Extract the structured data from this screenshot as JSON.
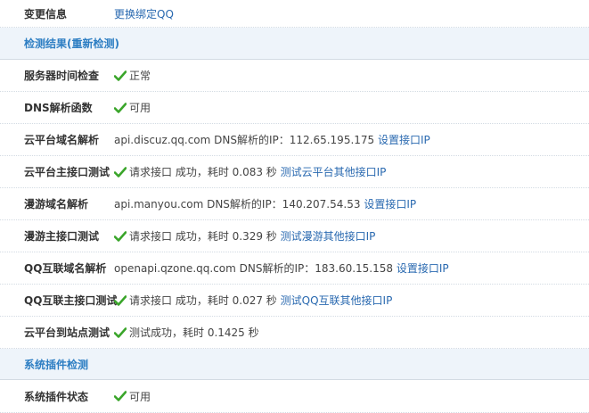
{
  "rows": {
    "change_info": {
      "label": "变更信息",
      "link": "更换绑定QQ"
    },
    "section_check": {
      "title": "检测结果(重新检测)"
    },
    "server_time": {
      "label": "服务器时间检查",
      "status": "正常"
    },
    "dns_func": {
      "label": "DNS解析函数",
      "status": "可用"
    },
    "cloud_dns": {
      "label": "云平台域名解析",
      "prefix": "api.discuz.qq.com DNS解析的IP：112.65.195.175",
      "link": "设置接口IP"
    },
    "cloud_main": {
      "label": "云平台主接口测试",
      "text": "请求接口 成功，耗时 0.083 秒",
      "link": "测试云平台其他接口IP"
    },
    "manyou_dns": {
      "label": "漫游域名解析",
      "prefix": "api.manyou.com DNS解析的IP：140.207.54.53",
      "link": "设置接口IP"
    },
    "manyou_main": {
      "label": "漫游主接口测试",
      "text": "请求接口 成功，耗时 0.329 秒",
      "link": "测试漫游其他接口IP"
    },
    "qq_dns": {
      "label": "QQ互联域名解析",
      "prefix": "openapi.qzone.qq.com DNS解析的IP：183.60.15.158",
      "link": "设置接口IP"
    },
    "qq_main": {
      "label": "QQ互联主接口测试",
      "text": "请求接口 成功，耗时 0.027 秒",
      "link": "测试QQ互联其他接口IP"
    },
    "cloud_site": {
      "label": "云平台到站点测试",
      "text": "测试成功，耗时 0.1425 秒"
    },
    "section_plugin": {
      "title": "系统插件检测"
    },
    "plugin_status": {
      "label": "系统插件状态",
      "status": "可用"
    }
  },
  "colors": {
    "check_green": "#3aa52a",
    "link_blue": "#2969b0",
    "section_bg": "#eef4fa",
    "section_text": "#2d7ec3"
  },
  "icons": {
    "check": "check-icon"
  }
}
